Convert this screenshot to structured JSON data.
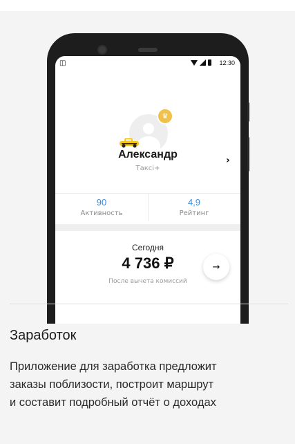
{
  "status_bar": {
    "time": "12:30"
  },
  "profile": {
    "name": "Александр",
    "class": "Таксі+"
  },
  "stats": [
    {
      "value": "90",
      "label": "Активность"
    },
    {
      "value": "4,9",
      "label": "Рейтинг"
    }
  ],
  "earnings": {
    "label": "Сегодня",
    "amount": "4 736 ₽",
    "note": "После вычета комиссий"
  },
  "section": {
    "title": "Заработок",
    "description_lines": [
      "Приложение для заработка предложит",
      "заказы поблизости, построит маршрут",
      "и составит подробный отчёт о доходах"
    ]
  },
  "colors": {
    "accent": "#3d8ed9",
    "badge": "#f0c14b",
    "taxi": "#f5c518"
  },
  "icons": [
    "vibrate-icon",
    "wifi-icon",
    "cellular-icon",
    "battery-icon",
    "crown-icon",
    "taxi-car-icon",
    "chevron-right-icon",
    "arrow-right-icon"
  ]
}
